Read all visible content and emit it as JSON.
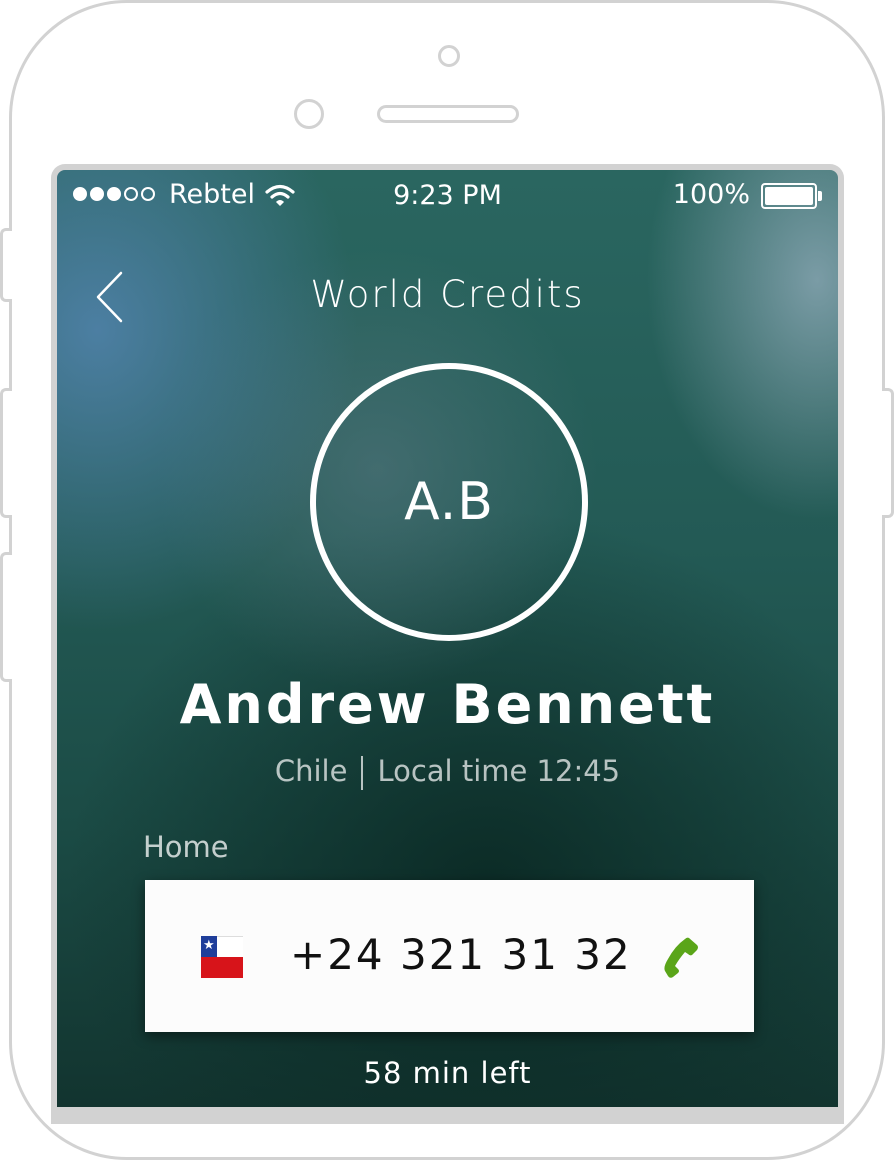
{
  "status_bar": {
    "signal_total": 5,
    "signal_filled": 3,
    "carrier": "Rebtel",
    "time": "9:23 PM",
    "battery_percent": "100%",
    "battery_level": 1.0
  },
  "nav": {
    "back_icon": "chevron-left-icon",
    "title": "World Credits"
  },
  "contact": {
    "initials": "A.B",
    "name": "Andrew Bennett",
    "country": "Chile",
    "local_time": "Local time 12:45"
  },
  "phone_entry": {
    "label": "Home",
    "flag_icon": "chile-flag-icon",
    "number": "+24 321 31 32",
    "call_icon": "phone-icon",
    "call_color": "#5aa519"
  },
  "credits": {
    "remaining": "58 min left"
  }
}
